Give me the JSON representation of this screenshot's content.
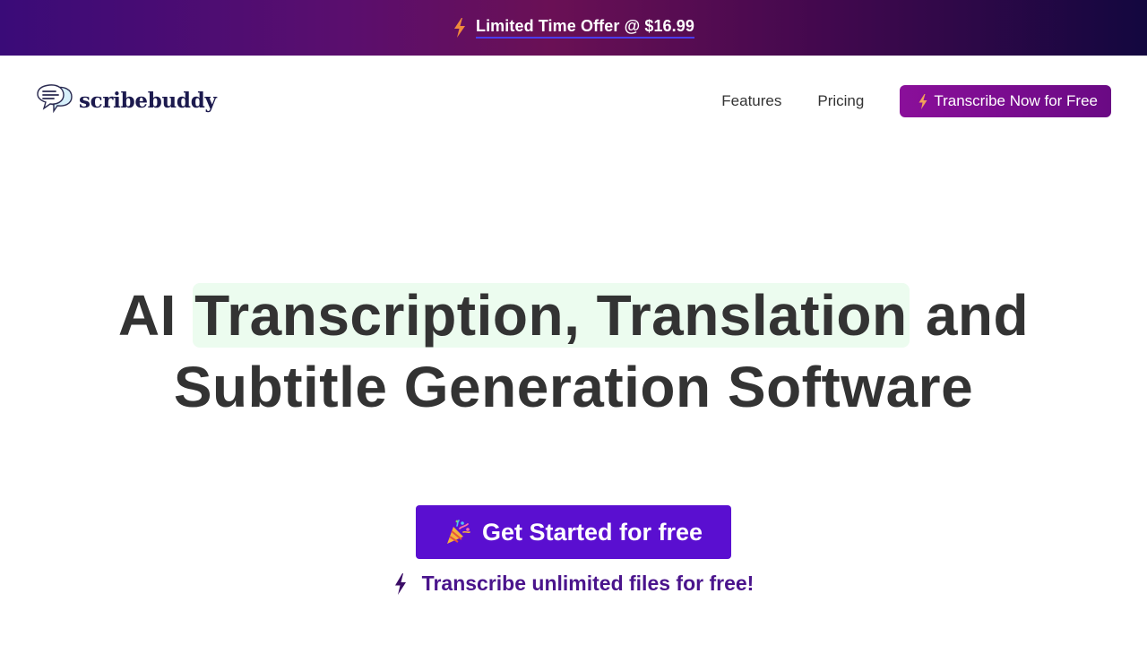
{
  "promo": {
    "text": "Limited Time Offer @ $16.99",
    "icon": "lightning-bolt-icon",
    "icon_color": "#f08a3c"
  },
  "header": {
    "logo_text": "scribebuddy",
    "logo_icon": "speech-bubbles-icon",
    "nav": {
      "features": "Features",
      "pricing": "Pricing"
    },
    "cta": {
      "label": "Transcribe Now for Free",
      "icon": "lightning-bolt-icon"
    }
  },
  "hero": {
    "title_line1_before": "AI ",
    "title_line1_highlight": "Transcription, Translation",
    "title_line1_after": " and",
    "title_line2": "Subtitle Generation Software",
    "highlight_color": "#ecfcef"
  },
  "main_cta": {
    "label": "Get Started for free",
    "icon": "party-popper-icon",
    "color": "#5a0fd0"
  },
  "tagline": {
    "text": "Transcribe unlimited files for free!",
    "icon": "lightning-bolt-icon",
    "color": "#4a148c"
  },
  "colors": {
    "brand_purple": "#8a0f9a",
    "text_dark": "#333333",
    "logo_navy": "#1c1a4e"
  }
}
